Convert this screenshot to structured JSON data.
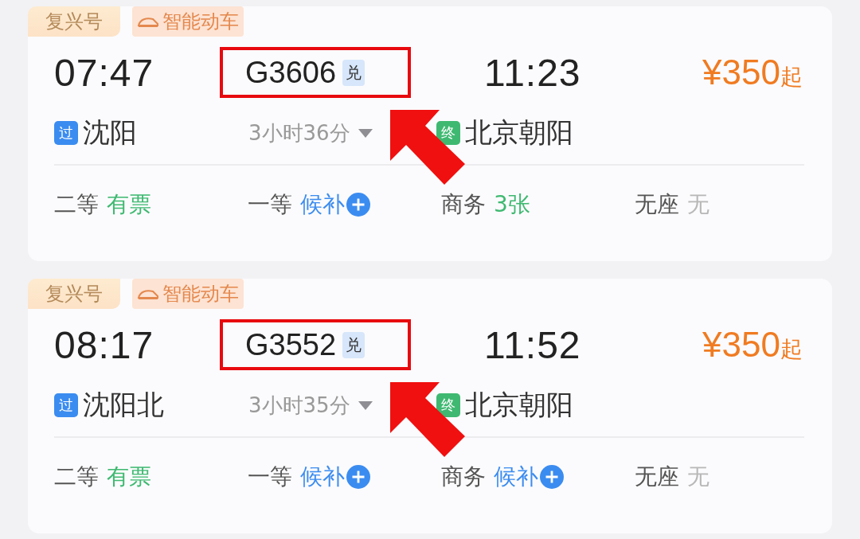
{
  "trains": [
    {
      "tags": [
        {
          "kind": "brand",
          "label": "复兴号"
        },
        {
          "kind": "smart",
          "label": "智能动车"
        }
      ],
      "depart_time": "07:47",
      "train_no": "G3606",
      "exchange_badge": "兑",
      "highlighted": true,
      "arrive_time": "11:23",
      "price": "¥350",
      "price_suffix": "起",
      "depart_badge": "过",
      "depart_station": "沈阳",
      "duration": "3小时36分",
      "arrive_badge": "终",
      "arrive_station": "北京朝阳",
      "seats": [
        {
          "class": "二等",
          "kind": "tickets",
          "availability": "有票"
        },
        {
          "class": "一等",
          "kind": "waitlist",
          "availability": "候补"
        },
        {
          "class": "商务",
          "kind": "tickets",
          "availability": "3张"
        },
        {
          "class": "无座",
          "kind": "none",
          "availability": "无"
        }
      ]
    },
    {
      "tags": [
        {
          "kind": "brand",
          "label": "复兴号"
        },
        {
          "kind": "smart",
          "label": "智能动车"
        }
      ],
      "depart_time": "08:17",
      "train_no": "G3552",
      "exchange_badge": "兑",
      "highlighted": true,
      "arrive_time": "11:52",
      "price": "¥350",
      "price_suffix": "起",
      "depart_badge": "过",
      "depart_station": "沈阳北",
      "duration": "3小时35分",
      "arrive_badge": "终",
      "arrive_station": "北京朝阳",
      "seats": [
        {
          "class": "二等",
          "kind": "tickets",
          "availability": "有票"
        },
        {
          "class": "一等",
          "kind": "waitlist",
          "availability": "候补"
        },
        {
          "class": "商务",
          "kind": "waitlist",
          "availability": "候补"
        },
        {
          "class": "无座",
          "kind": "none",
          "availability": "无"
        }
      ]
    }
  ]
}
